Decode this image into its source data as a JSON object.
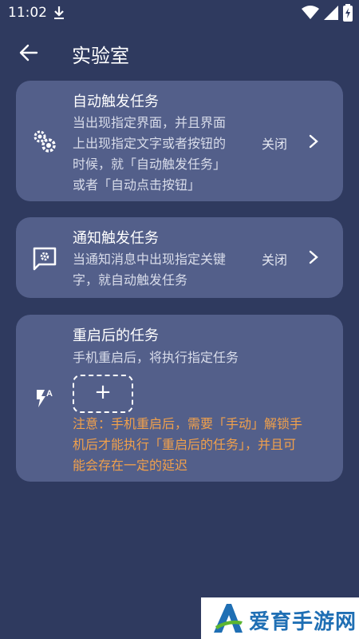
{
  "status_bar": {
    "time": "11:02"
  },
  "app_bar": {
    "title": "实验室"
  },
  "cards": [
    {
      "title": "自动触发任务",
      "desc_lines": [
        "当出现指定界面，并且界面",
        "上出现指定文字或者按钮的",
        "时候，就「自动触发任务」",
        "或者「自动点击按钮」"
      ],
      "state": "关闭"
    },
    {
      "title": "通知触发任务",
      "desc_lines": [
        "当通知消息中出现指定关键",
        "字，就自动触发任务"
      ],
      "state": "关闭"
    },
    {
      "title": "重启后的任务",
      "desc": "手机重启后，将执行指定任务",
      "add_symbol": "+",
      "warning_lines": [
        "注意：手机重启后，需要「手动」解锁手",
        "机后才能执行「重启后的任务」，并且可",
        "能会存在一定的延迟"
      ]
    }
  ],
  "watermark": {
    "text": "爱育手游网",
    "letter": "A"
  },
  "colors": {
    "background": "#2f3a5f",
    "card": "#535f8a",
    "warning": "#f0a04c"
  }
}
